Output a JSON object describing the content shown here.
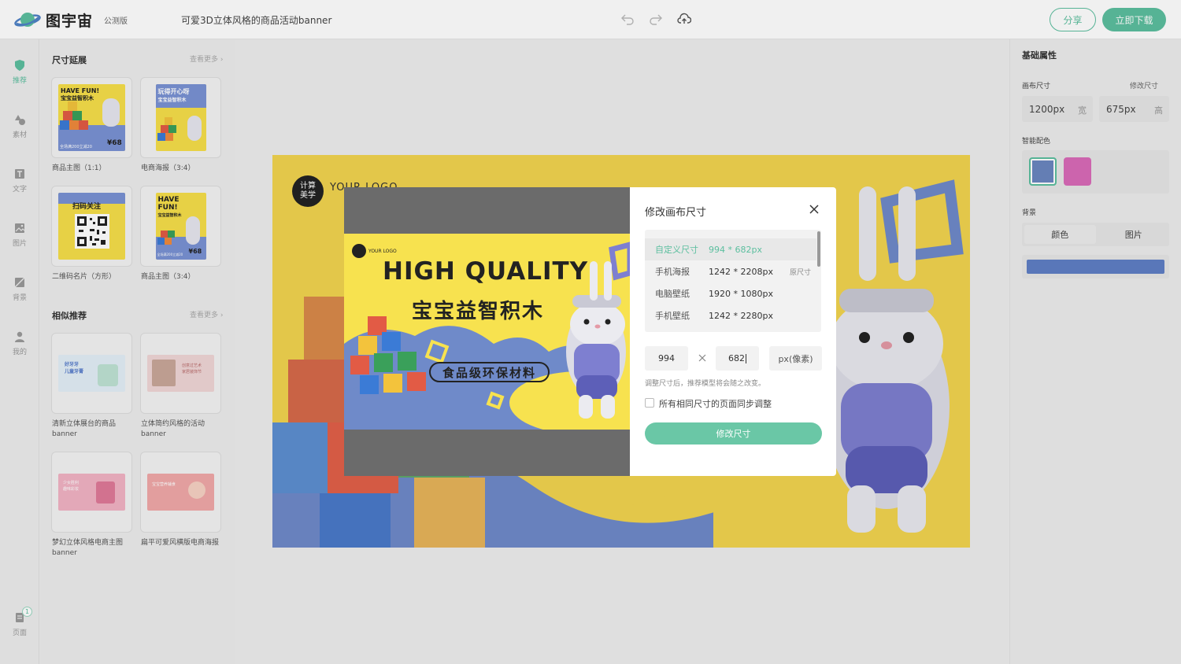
{
  "app": {
    "name": "图宇宙",
    "badge": "公测版",
    "doc_title": "可爱3D立体风格的商品活动banner",
    "share_label": "分享",
    "download_label": "立即下载",
    "accent_color": "#5cbf9f"
  },
  "rail": {
    "items": [
      {
        "label": "推荐",
        "icon": "shield-icon",
        "active": true
      },
      {
        "label": "素材",
        "icon": "shapes-icon"
      },
      {
        "label": "文字",
        "icon": "text-icon"
      },
      {
        "label": "图片",
        "icon": "image-icon"
      },
      {
        "label": "背景",
        "icon": "background-icon"
      },
      {
        "label": "我的",
        "icon": "user-icon"
      }
    ],
    "pages_label": "页面",
    "pages_count": "1"
  },
  "left_panel": {
    "size_section": {
      "title": "尺寸延展",
      "more": "查看更多",
      "items": [
        {
          "caption": "商品主图（1:1）"
        },
        {
          "caption": "电商海报（3:4）"
        },
        {
          "caption": "二维码名片（方形）"
        },
        {
          "caption": "商品主图（3:4）"
        }
      ]
    },
    "similar_section": {
      "title": "相似推荐",
      "more": "查看更多",
      "items": [
        {
          "caption": "清新立体展台的商品banner"
        },
        {
          "caption": "立体简约风格的活动banner"
        },
        {
          "caption": "梦幻立体风格电商主图banner"
        },
        {
          "caption": "扁平可爱风横版电商海报"
        }
      ]
    }
  },
  "thumbs_text": {
    "t1_line1": "HAVE FUN!",
    "t1_line2": "宝宝益智积木",
    "t1_bottom": "全场满200立减20",
    "t1_price": "¥68",
    "t2_line1": "玩得开心呀",
    "t2_line2": "宝宝益智积木",
    "t3_line1": "扫码关注",
    "t4_line1": "HAVE",
    "t4_line2": "FUN!",
    "t4_line3": "宝宝益智积木",
    "t4_bottom": "全场满200立减20",
    "t4_price": "¥68",
    "s1_line1": "好牙牙",
    "s1_line2": "儿童牙膏",
    "s2_line1": "创意过艺术",
    "s2_line2": "家居装饰节",
    "s3_line1": "少女胜利",
    "s3_line2": "趣味彩妆",
    "s4_line1": "宝宝营养辅食"
  },
  "canvas": {
    "logo_circle": "计算美学",
    "logo_text": "YOUR LOGO"
  },
  "right_panel": {
    "title": "基础属性",
    "canvas_size_label": "画布尺寸",
    "modify_link": "修改尺寸",
    "width_value": "1200px",
    "width_unit": "宽",
    "height_value": "675px",
    "height_unit": "高",
    "smart_color_label": "智能配色",
    "swatches": [
      "#6b86c0",
      "#d96bb8"
    ],
    "bg_label": "背景",
    "bg_tabs": [
      "颜色",
      "图片"
    ],
    "bg_color": "#5f7fc5"
  },
  "preview": {
    "logo_text": "YOUR LOGO",
    "headline": "HIGH QUALITY",
    "subline": "宝宝益智积木",
    "tag": "食品级环保材料"
  },
  "dialog": {
    "title": "修改画布尺寸",
    "presets": [
      {
        "name": "自定义尺寸",
        "size": "994 * 682px",
        "selected": true
      },
      {
        "name": "手机海报",
        "size": "1242 * 2208px",
        "origin": "原尺寸"
      },
      {
        "name": "电脑壁纸",
        "size": "1920 * 1080px"
      },
      {
        "name": "手机壁纸",
        "size": "1242 * 2280px"
      }
    ],
    "width_input": "994",
    "height_input": "682",
    "unit": "px(像素)",
    "hint": "调整尺寸后，推荐模型将会随之改变。",
    "sync_label": "所有相同尺寸的页面同步调整",
    "submit_label": "修改尺寸"
  }
}
